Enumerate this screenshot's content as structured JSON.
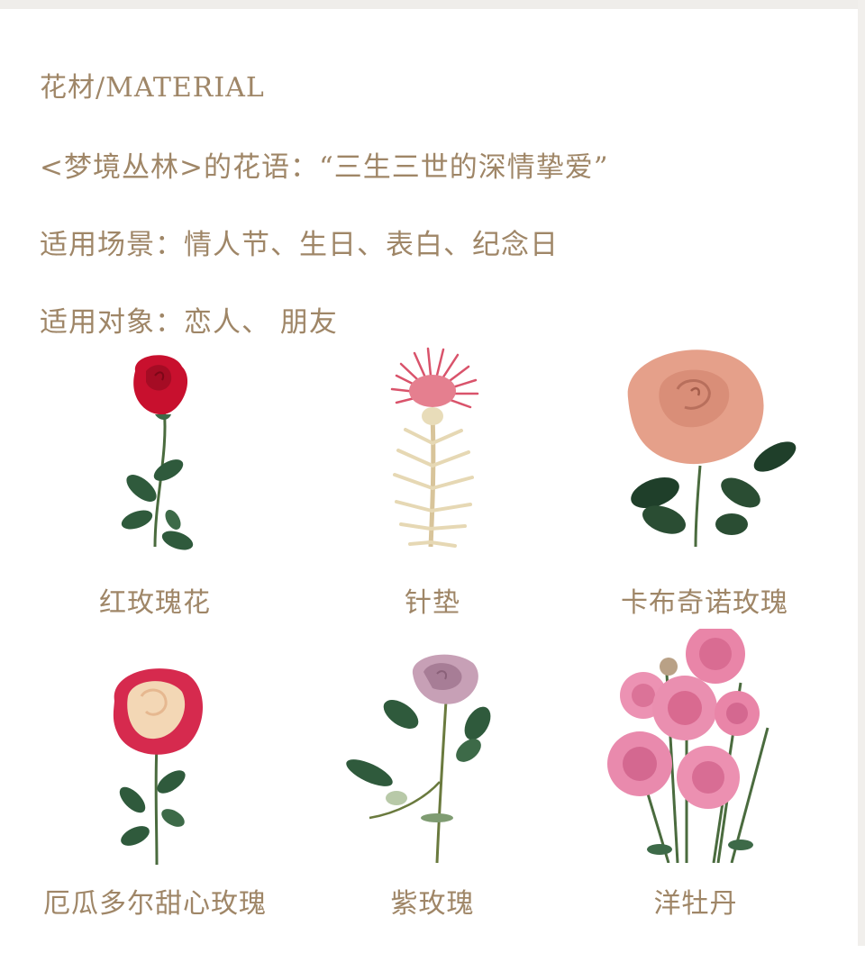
{
  "header": {
    "material_title": "花材/MATERIAL",
    "flower_language": "<梦境丛林>的花语：“三生三世的深情挚爱”",
    "scenes": "适用场景：情人节、生日、表白、纪念日",
    "targets": "适用对象：恋人、 朋友"
  },
  "flowers": [
    {
      "name": "红玫瑰花",
      "icon": "red-rose-image"
    },
    {
      "name": "针垫",
      "icon": "pincushion-protea-image"
    },
    {
      "name": "卡布奇诺玫瑰",
      "icon": "cappuccino-rose-image"
    },
    {
      "name": "厄瓜多尔甜心玫瑰",
      "icon": "sweetheart-rose-image"
    },
    {
      "name": "紫玫瑰",
      "icon": "purple-rose-image"
    },
    {
      "name": "洋牡丹",
      "icon": "ranunculus-image"
    }
  ],
  "colors": {
    "text": "#9f8667",
    "background": "#ffffff"
  }
}
